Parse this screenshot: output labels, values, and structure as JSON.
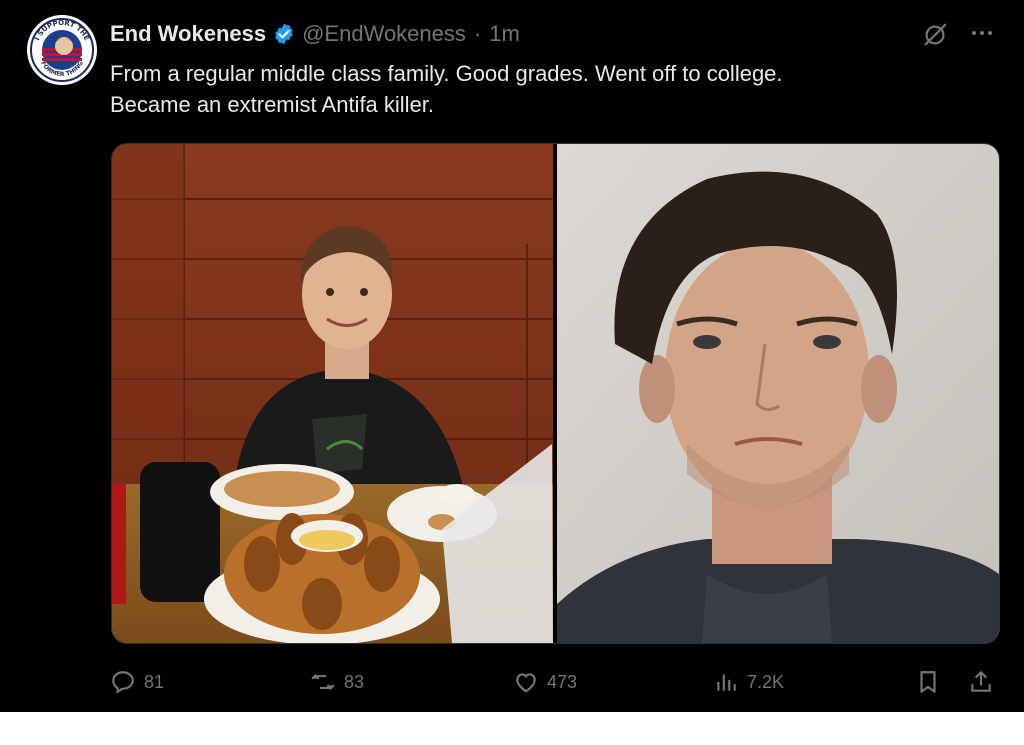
{
  "author": {
    "display_name": "End Wokeness",
    "handle": "@EndWokeness",
    "separator": "·",
    "time": "1m",
    "avatar_text": [
      "I SUPPORT THE",
      "FORMER THING"
    ]
  },
  "tweet": {
    "line1": "From a regular middle class family. Good grades. Went off to college.",
    "line2": "Became an extremist Antifa killer."
  },
  "media": {
    "left_image": "boy-at-restaurant-photo",
    "right_image": "adult-mugshot-photo"
  },
  "actions": {
    "replies": "81",
    "reposts": "83",
    "likes": "473",
    "views": "7.2K"
  },
  "colors": {
    "background": "#000000",
    "text": "#e7e9ea",
    "muted": "#71767b",
    "verified": "#1d9bf0"
  }
}
